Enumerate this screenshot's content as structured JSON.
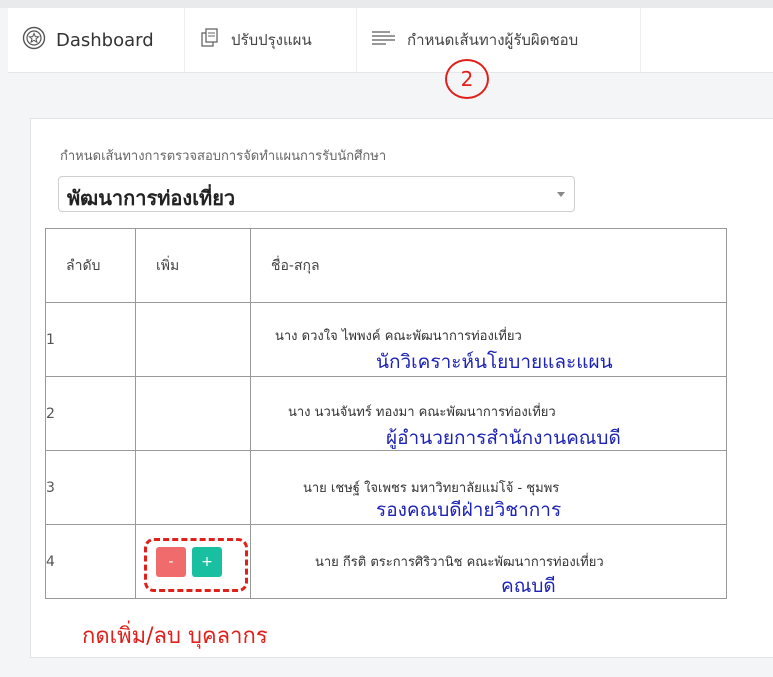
{
  "tabs": [
    {
      "label": "Dashboard",
      "icon": "dashboard-icon"
    },
    {
      "label": "ปรับปรุงแผน",
      "icon": "edit-document-icon"
    },
    {
      "label": "กำหนดเส้นทางผู้รับผิดชอบ",
      "icon": "list-icon"
    }
  ],
  "annotation_step": "2",
  "form": {
    "section_label": "กำหนดเส้นทางการตรวจสอบการจัดทำแผนการรับนักศึกษา",
    "select_value": "พัฒนาการท่องเที่ยว"
  },
  "table": {
    "headers": [
      "ลำดับ",
      "เพิ่ม",
      "ชื่อ-สกุล"
    ],
    "rows": [
      {
        "num": "1",
        "name": "นาง ดวงใจ ไพพงค์ คณะพัฒนาการท่องเที่ยว",
        "position": "นักวิเคราะห์นโยบายและแผน"
      },
      {
        "num": "2",
        "name": "นาง นวนจันทร์ ทองมา คณะพัฒนาการท่องเที่ยว",
        "position": "ผู้อำนวยการสำนักงานคณบดี"
      },
      {
        "num": "3",
        "name": "นาย เชษฐ์ ใจเพชร มหาวิทยาลัยแม่โจ้ - ชุมพร",
        "position": "รองคณบดีฝ่ายวิชาการ"
      },
      {
        "num": "4",
        "name": "นาย กีรติ ตระการศิริวานิช คณะพัฒนาการท่องเที่ยว",
        "position": "คณบดี",
        "minus_label": "-",
        "plus_label": "+"
      }
    ]
  },
  "annotation_text": "กดเพิ่ม/ลบ บุคลากร",
  "colors": {
    "annotation_red": "#e0211b",
    "position_blue": "#1d23b5",
    "minus_button": "#f06b6b",
    "plus_button": "#18c0a1"
  }
}
